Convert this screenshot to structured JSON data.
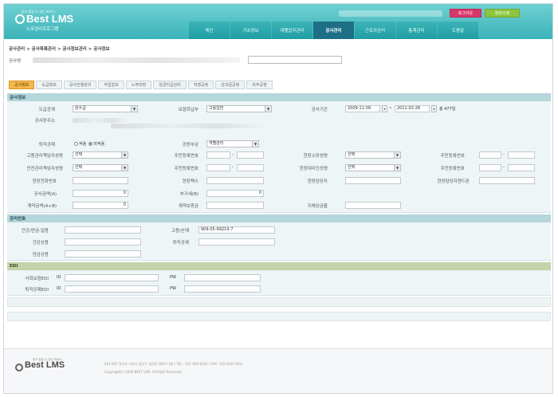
{
  "header": {
    "logo_sub": "믿고 맡길 수 있는 파트너",
    "logo_main": "Best LMS",
    "logo_kr": "노무관리프로그램",
    "btn_logout": "로그아웃",
    "btn_info": "정보수정"
  },
  "nav": [
    "메인",
    "기초정보",
    "대행업무관리",
    "공사관리",
    "근로자관리",
    "통계관리",
    "도움말"
  ],
  "breadcrumb": "공사관리 > 공사목록관리 > 공사정보관리 > 공사정보",
  "project_label": "공사명",
  "tabs": [
    "공사정보",
    "도급정보",
    "공사진행관리",
    "작업일보",
    "노무대장",
    "임금지급관리",
    "직영공정",
    "성과금공정",
    "외주공정"
  ],
  "section_info": {
    "title": "공사정보",
    "contract_type_label": "도급관계",
    "contract_type_value": "원수급",
    "insurance_label": "보험회납부",
    "insurance_value": "고용일반",
    "period_label": "공사기간",
    "period_start": "2009-11-09",
    "period_sep": "~",
    "period_end": "2011-02-28",
    "period_total": "총 477일",
    "location_label": "공사장주소",
    "location_value": "공사현장주소",
    "retire_label": "퇴직공제",
    "retire_opt1": "적용",
    "retire_opt2": "미적용",
    "contract_kind_label": "공동부금",
    "contract_kind_value": "개별관리",
    "emp_mgr_label": "고용관리책임자성명",
    "safe_mgr_label": "안전관리책임자성명",
    "select_placeholder": "선택",
    "rrn_label": "주민등록번호",
    "rrn_sep": "-",
    "site_chief_label": "현장소장성명",
    "site_agent_label": "현장대리인성명",
    "site_phone_label": "현장전화번호",
    "site_fax_label": "현장팩스",
    "site_manager_label": "현장담당자",
    "site_manager_phone_label": "현장담당자핸드폰",
    "amount_a_label": "공사금액(A)",
    "amount_a_value": "0",
    "vat_b_label": "부가세(B)",
    "vat_b_value": "0",
    "contract_ab_label": "계약금액(A+B)",
    "contract_ab_value": "0",
    "contract_bond_label": "계약보증금",
    "exclusion_label": "지체상금율"
  },
  "section_mgmt": {
    "title": "관리번호",
    "health_label": "건강/연금-일용",
    "employ_label": "고용/산재",
    "employ_value": "909-05-99219-7",
    "health_reg_label": "건강상용",
    "retire_mgmt_label": "퇴직공제",
    "pension_reg_label": "연금상용"
  },
  "section_edi": {
    "title": "EDI",
    "social_label": "사회보험EDI",
    "retire_label": "퇴직공제EDI",
    "id_label": "ID",
    "pw_label": "PW"
  },
  "footer": {
    "logo": "Best LMS",
    "logo_sub": "믿고 맡길 수 있는 파트너",
    "address": "441-857 경기도 수원시 권선구 세류동 000-0 3층 / TEL : 031-000-1001 / FAX : 031-000-7002",
    "copyright": "Copyright(c) 2008 BEST LMS. All Right Reserved."
  }
}
